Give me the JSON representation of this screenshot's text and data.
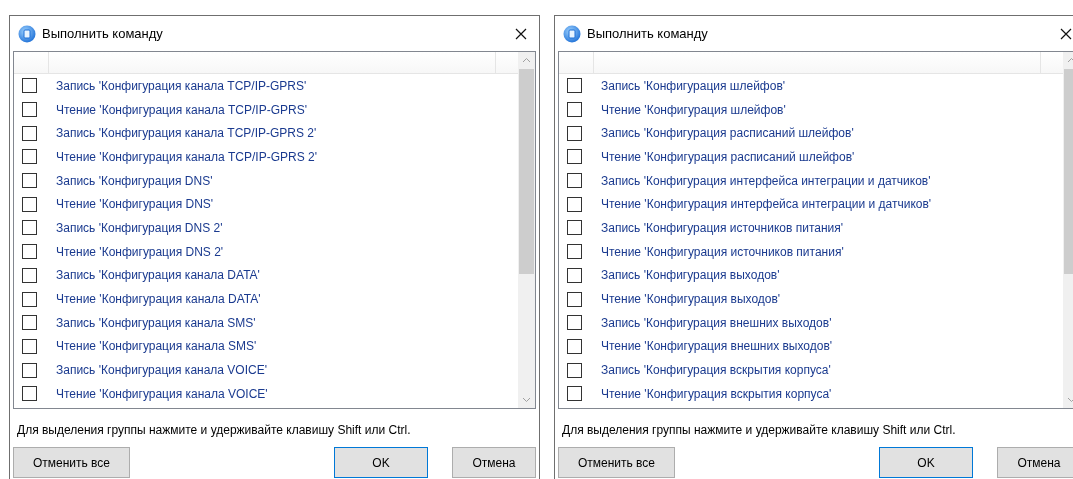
{
  "dialogs": [
    {
      "title": "Выполнить команду",
      "items": [
        {
          "label": "Запись 'Конфигурация канала TCP/IP-GPRS'",
          "checked": false
        },
        {
          "label": "Чтение 'Конфигурация канала TCP/IP-GPRS'",
          "checked": false
        },
        {
          "label": "Запись 'Конфигурация канала TCP/IP-GPRS 2'",
          "checked": false
        },
        {
          "label": "Чтение 'Конфигурация канала TCP/IP-GPRS 2'",
          "checked": false
        },
        {
          "label": "Запись 'Конфигурация DNS'",
          "checked": false
        },
        {
          "label": "Чтение 'Конфигурация DNS'",
          "checked": false
        },
        {
          "label": "Запись 'Конфигурация DNS 2'",
          "checked": false
        },
        {
          "label": "Чтение 'Конфигурация DNS 2'",
          "checked": false
        },
        {
          "label": "Запись 'Конфигурация канала DATA'",
          "checked": false
        },
        {
          "label": "Чтение 'Конфигурация канала DATA'",
          "checked": false
        },
        {
          "label": "Запись 'Конфигурация канала SMS'",
          "checked": false
        },
        {
          "label": "Чтение 'Конфигурация канала SMS'",
          "checked": false
        },
        {
          "label": "Запись 'Конфигурация канала VOICE'",
          "checked": false
        },
        {
          "label": "Чтение 'Конфигурация канала VOICE'",
          "checked": false
        }
      ],
      "hint": "Для выделения группы нажмите и удерживайте клавишу Shift или Ctrl.",
      "buttons": [
        {
          "label": "Отменить все",
          "default": false
        },
        {
          "label": "OK",
          "default": true
        },
        {
          "label": "Отмена",
          "default": false
        }
      ]
    },
    {
      "title": "Выполнить команду",
      "items": [
        {
          "label": "Запись 'Конфигурация шлейфов'",
          "checked": false
        },
        {
          "label": "Чтение 'Конфигурация шлейфов'",
          "checked": false
        },
        {
          "label": "Запись 'Конфигурация расписаний шлейфов'",
          "checked": false
        },
        {
          "label": "Чтение 'Конфигурация расписаний шлейфов'",
          "checked": false
        },
        {
          "label": "Запись 'Конфигурация интерфейса интеграции и датчиков'",
          "checked": false
        },
        {
          "label": "Чтение 'Конфигурация интерфейса интеграции и датчиков'",
          "checked": false
        },
        {
          "label": "Запись 'Конфигурация источников питания'",
          "checked": false
        },
        {
          "label": "Чтение 'Конфигурация источников питания'",
          "checked": false
        },
        {
          "label": "Запись 'Конфигурация выходов'",
          "checked": false
        },
        {
          "label": "Чтение 'Конфигурация выходов'",
          "checked": false
        },
        {
          "label": "Запись 'Конфигурация внешних выходов'",
          "checked": false
        },
        {
          "label": "Чтение 'Конфигурация внешних выходов'",
          "checked": false
        },
        {
          "label": "Запись 'Конфигурация вскрытия корпуса'",
          "checked": false
        },
        {
          "label": "Чтение 'Конфигурация вскрытия корпуса'",
          "checked": false
        }
      ],
      "hint": "Для выделения группы нажмите и удерживайте клавишу Shift или Ctrl.",
      "buttons": [
        {
          "label": "Отменить все",
          "default": false
        },
        {
          "label": "OK",
          "default": true
        },
        {
          "label": "Отмена",
          "default": false
        }
      ]
    }
  ]
}
